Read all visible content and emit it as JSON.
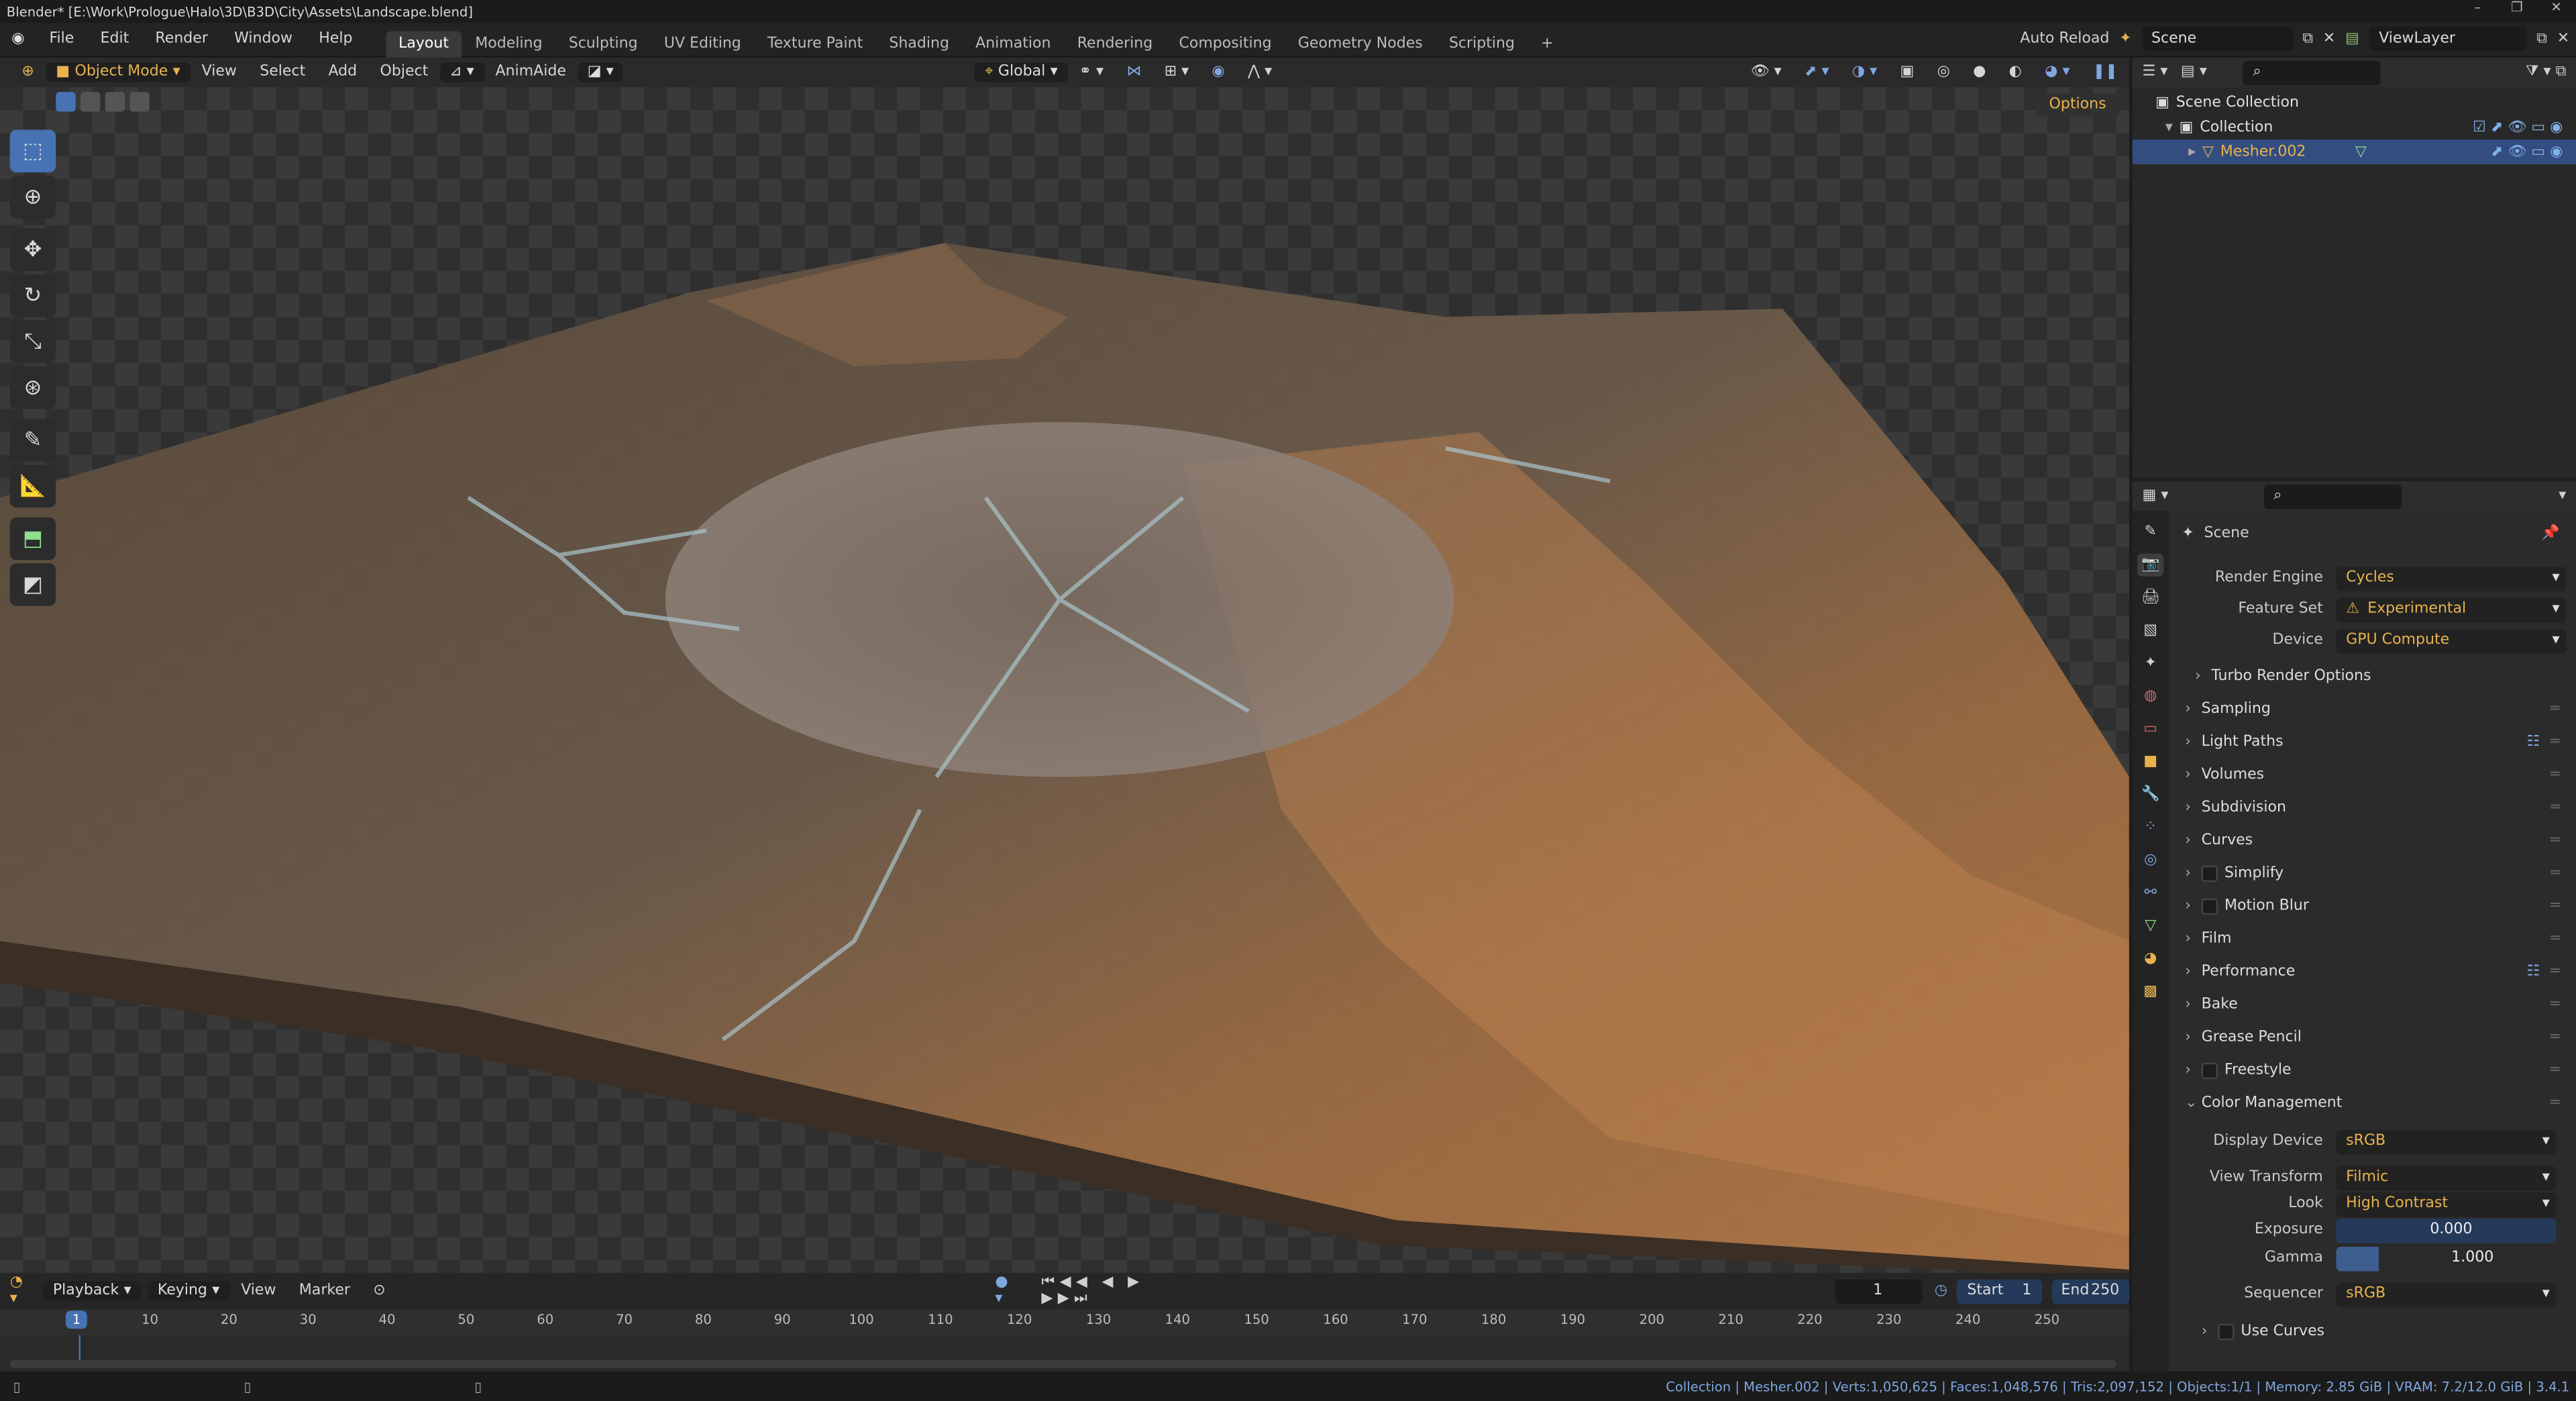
{
  "window": {
    "title": "Blender* [E:\\Work\\Prologue\\Halo\\3D\\B3D\\City\\Assets\\Landscape.blend]",
    "controls": [
      "–",
      "❐",
      "✕"
    ]
  },
  "menubar": {
    "menus": [
      "File",
      "Edit",
      "Render",
      "Window",
      "Help"
    ],
    "workspaces": [
      "Layout",
      "Modeling",
      "Sculpting",
      "UV Editing",
      "Texture Paint",
      "Shading",
      "Animation",
      "Rendering",
      "Compositing",
      "Geometry Nodes",
      "Scripting"
    ],
    "active_workspace": "Layout",
    "add_tab": "+",
    "auto_reload": "Auto Reload",
    "scene": "Scene",
    "view_layer": "ViewLayer"
  },
  "viewport_header": {
    "mode": "Object Mode",
    "menus": [
      "View",
      "Select",
      "Add",
      "Object"
    ],
    "addon": "AnimAide",
    "transform_orientation": "Global",
    "options": "Options"
  },
  "toolbar": {
    "tools": [
      "select-box",
      "cursor",
      "move",
      "rotate",
      "scale",
      "transform",
      "annotate",
      "measure",
      "add-cube",
      "extrude"
    ]
  },
  "outliner": {
    "rows": [
      {
        "label": "Scene Collection",
        "indent": 0,
        "selected": false
      },
      {
        "label": "Collection",
        "indent": 1,
        "selected": false
      },
      {
        "label": "Mesher.002",
        "indent": 2,
        "selected": true
      }
    ]
  },
  "properties": {
    "context": "Scene",
    "render_engine": {
      "label": "Render Engine",
      "value": "Cycles"
    },
    "feature_set": {
      "label": "Feature Set",
      "value": "Experimental"
    },
    "device": {
      "label": "Device",
      "value": "GPU Compute"
    },
    "turbo": "Turbo Render Options",
    "panels": [
      "Sampling",
      "Light Paths",
      "Volumes",
      "Subdivision",
      "Curves",
      "Simplify",
      "Motion Blur",
      "Film",
      "Performance",
      "Bake",
      "Grease Pencil",
      "Freestyle"
    ],
    "color_management": {
      "title": "Color Management",
      "display_device": {
        "label": "Display Device",
        "value": "sRGB"
      },
      "view_transform": {
        "label": "View Transform",
        "value": "Filmic"
      },
      "look": {
        "label": "Look",
        "value": "High Contrast"
      },
      "exposure": {
        "label": "Exposure",
        "value": "0.000"
      },
      "gamma": {
        "label": "Gamma",
        "value": "1.000"
      },
      "sequencer": {
        "label": "Sequencer",
        "value": "sRGB"
      },
      "use_curves": "Use Curves"
    }
  },
  "timeline": {
    "menus": [
      "Playback",
      "Keying",
      "View",
      "Marker"
    ],
    "current_frame": "1",
    "start_label": "Start",
    "start": "1",
    "end_label": "End",
    "end": "250",
    "ticks": [
      "1",
      "10",
      "20",
      "30",
      "40",
      "50",
      "60",
      "70",
      "80",
      "90",
      "100",
      "110",
      "120",
      "130",
      "140",
      "150",
      "160",
      "170",
      "180",
      "190",
      "200",
      "210",
      "220",
      "230",
      "240",
      "250"
    ]
  },
  "statusbar": {
    "text": "Collection | Mesher.002 | Verts:1,050,625 | Faces:1,048,576 | Tris:2,097,152 | Objects:1/1 | Memory: 2.85 GiB | VRAM: 7.2/12.0 GiB | 3.4.1"
  },
  "colors": {
    "accent": "#4772b3",
    "highlight": "#e8b34c",
    "terrain": "#b07a4a"
  }
}
